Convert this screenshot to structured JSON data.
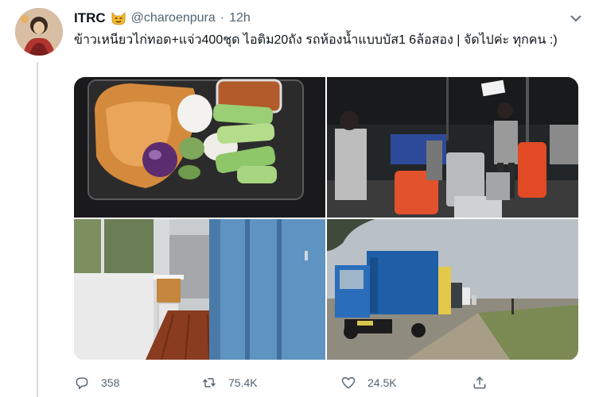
{
  "tweet": {
    "display_name": "ITRC",
    "handle": "@charoenpura",
    "separator": "·",
    "time": "12h",
    "text": "ข้าวเหนียวไก่ทอด+แจ่ว400ชุด ไอติม20ถัง รถห้องน้ำแบบบัส1 6ล้อสอง | จัดไปค่ะ ทุกคน :)",
    "emoji_icon": "smiling-cat-face-icon"
  },
  "media": [
    {
      "name": "food-box-photo"
    },
    {
      "name": "kitchen-photo"
    },
    {
      "name": "restroom-bus-interior-photo"
    },
    {
      "name": "restroom-trucks-photo"
    }
  ],
  "actions": {
    "reply_count": "358",
    "retweet_count": "75.4K",
    "like_count": "24.5K"
  },
  "colors": {
    "text": "#0f1419",
    "secondary": "#536471",
    "thread_line": "#cfd9de"
  }
}
